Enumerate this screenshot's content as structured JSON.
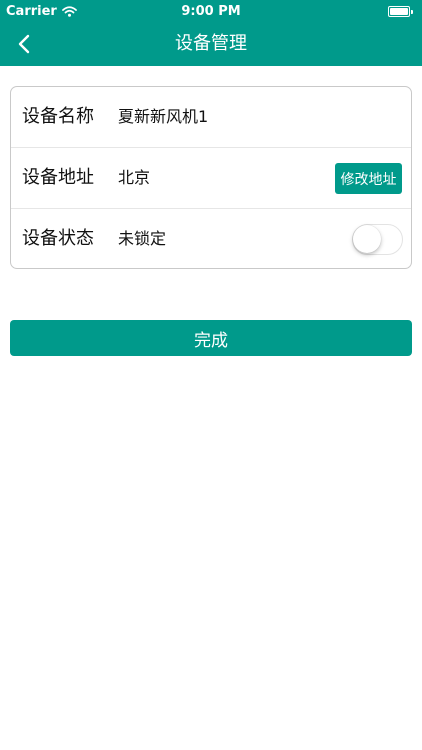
{
  "status_bar": {
    "carrier": "Carrier",
    "time": "9:00 PM"
  },
  "nav": {
    "title": "设备管理",
    "back_icon": "chevron-left-icon"
  },
  "device": {
    "name_label": "设备名称",
    "name_value": "夏新新风机1",
    "address_label": "设备地址",
    "address_value": "北京",
    "edit_address_label": "修改地址",
    "status_label": "设备状态",
    "status_value": "未锁定",
    "lock_toggle_on": false
  },
  "actions": {
    "done_label": "完成"
  },
  "colors": {
    "accent": "#009a8b",
    "card_border": "#c9c9c9"
  }
}
